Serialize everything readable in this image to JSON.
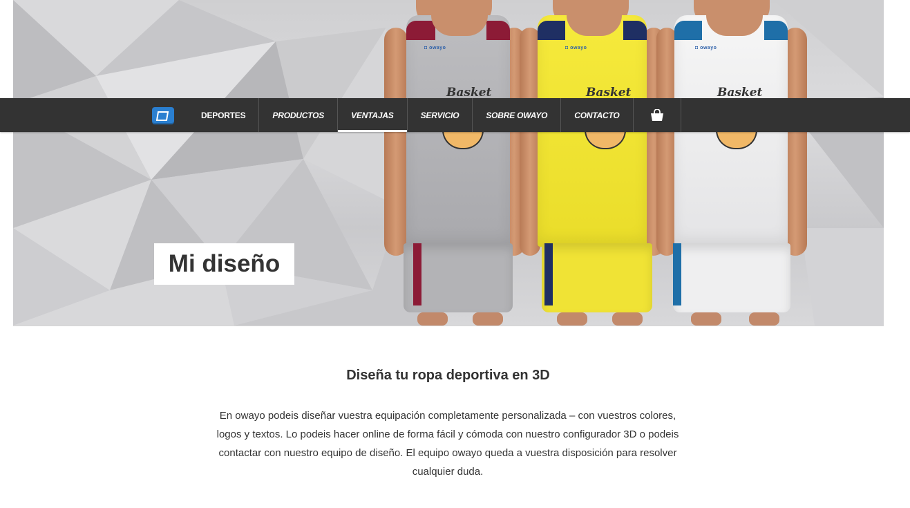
{
  "nav": {
    "logo_icon": "owayo-logo-icon",
    "items": [
      {
        "label": "DEPORTES"
      },
      {
        "label": "PRODUCTOS"
      },
      {
        "label": "VENTAJAS"
      },
      {
        "label": "SERVICIO"
      },
      {
        "label": "SOBRE OWAYO"
      },
      {
        "label": "CONTACTO"
      }
    ],
    "active_item": "VENTAJAS",
    "cart_icon": "shopping-bag-icon",
    "background": "#333333"
  },
  "hero": {
    "title": "Mi diseño",
    "players": [
      {
        "jersey_color": "#b9b9bc",
        "accent": "#8c1b36",
        "brand": "owayo",
        "script": "Basket"
      },
      {
        "jersey_color": "#f2e63a",
        "accent": "#1f2f63",
        "brand": "owayo",
        "script": "Basket"
      },
      {
        "jersey_color": "#f0f0f0",
        "accent": "#1f6fa8",
        "brand": "owayo",
        "script": "Basket"
      }
    ]
  },
  "content": {
    "heading": "Diseña tu ropa deportiva en 3D",
    "body": "En owayo podeis diseñar vuestra equipación completamente personalizada – con vuestros colores, logos y textos. Lo podeis hacer online de forma fácil y cómoda con nuestro configurador 3D o podeis contactar con nuestro equipo de diseño. El equipo owayo queda a vuestra disposición para resolver cualquier duda."
  }
}
